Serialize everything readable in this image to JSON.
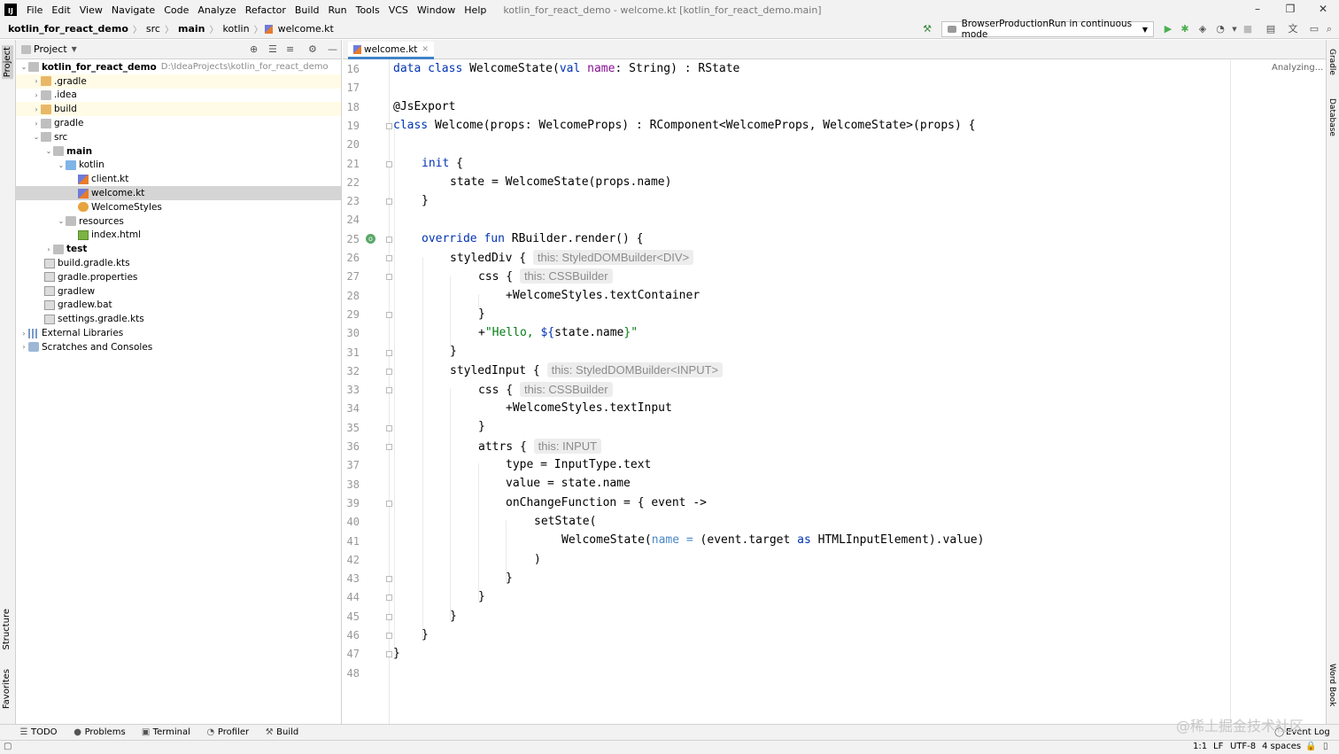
{
  "title_bar": {
    "app_icon": "intellij-icon",
    "menu": [
      "File",
      "Edit",
      "View",
      "Navigate",
      "Code",
      "Analyze",
      "Refactor",
      "Build",
      "Run",
      "Tools",
      "VCS",
      "Window",
      "Help"
    ],
    "window_title": "kotlin_for_react_demo - welcome.kt [kotlin_for_react_demo.main]"
  },
  "breadcrumbs": [
    "kotlin_for_react_demo",
    "src",
    "main",
    "kotlin",
    "welcome.kt"
  ],
  "run_config": "BrowserProductionRun in continuous mode",
  "left_strip": {
    "project": "Project",
    "structure": "Structure",
    "favorites": "Favorites"
  },
  "right_strip": {
    "gradle": "Gradle",
    "database": "Database",
    "word_book": "Word Book"
  },
  "project_panel": {
    "header": "Project",
    "tree": [
      {
        "label": "kotlin_for_react_demo",
        "hint": "D:\\IdeaProjects\\kotlin_for_react_demo",
        "bold": true
      },
      {
        "label": ".gradle"
      },
      {
        "label": ".idea"
      },
      {
        "label": "build"
      },
      {
        "label": "gradle"
      },
      {
        "label": "src"
      },
      {
        "label": "main",
        "bold": true
      },
      {
        "label": "kotlin"
      },
      {
        "label": "client.kt"
      },
      {
        "label": "welcome.kt"
      },
      {
        "label": "WelcomeStyles"
      },
      {
        "label": "resources"
      },
      {
        "label": "index.html"
      },
      {
        "label": "test",
        "bold": true
      },
      {
        "label": "build.gradle.kts"
      },
      {
        "label": "gradle.properties"
      },
      {
        "label": "gradlew"
      },
      {
        "label": "gradlew.bat"
      },
      {
        "label": "settings.gradle.kts"
      },
      {
        "label": "External Libraries"
      },
      {
        "label": "Scratches and Consoles"
      }
    ]
  },
  "editor": {
    "tab": "welcome.kt",
    "status": "Analyzing...",
    "line_numbers": [
      "16",
      "17",
      "18",
      "19",
      "20",
      "21",
      "22",
      "23",
      "24",
      "25",
      "26",
      "27",
      "28",
      "29",
      "30",
      "31",
      "32",
      "33",
      "34",
      "35",
      "36",
      "37",
      "38",
      "39",
      "40",
      "41",
      "42",
      "43",
      "44",
      "45",
      "46",
      "47",
      "48"
    ],
    "lines": {
      "l16": {
        "a": "data class ",
        "b": "WelcomeState(",
        "c": "val ",
        "d": "name",
        "e": ": String) : RState"
      },
      "l18": "@JsExport",
      "l19": {
        "a": "class ",
        "b": "Welcome(props: WelcomeProps) : RComponent<WelcomeProps, WelcomeState>(props) {"
      },
      "l21": {
        "a": "init ",
        "b": "{"
      },
      "l22": "state = WelcomeState(props.name)",
      "l23": "}",
      "l25": {
        "a": "override fun ",
        "b": "RBuilder.render() {"
      },
      "l26": {
        "a": "styledDiv {",
        "hint": "this: StyledDOMBuilder<DIV>"
      },
      "l27": {
        "a": "css {",
        "hint": "this: CSSBuilder"
      },
      "l28": "+WelcomeStyles.textContainer",
      "l29": "}",
      "l30": {
        "a": "+",
        "b": "\"Hello, ",
        "c": "${",
        "d": "state.name",
        "e": "}\""
      },
      "l31": "}",
      "l32": {
        "a": "styledInput {",
        "hint": "this: StyledDOMBuilder<INPUT>"
      },
      "l33": {
        "a": "css {",
        "hint": "this: CSSBuilder"
      },
      "l34": "+WelcomeStyles.textInput",
      "l35": "}",
      "l36": {
        "a": "attrs {",
        "hint": "this: INPUT"
      },
      "l37": "type = InputType.text",
      "l38": "value = state.name",
      "l39": "onChangeFunction = { event ->",
      "l40": "setState(",
      "l41": {
        "a": "WelcomeState(",
        "b": "name = ",
        "c": "(event.target ",
        "d": "as ",
        "e": "HTMLInputElement).value)"
      },
      "l42": ")",
      "l43": "}",
      "l44": "}",
      "l45": "}",
      "l46": "}",
      "l47": "}"
    }
  },
  "bottom_tabs": [
    "TODO",
    "Problems",
    "Terminal",
    "Profiler",
    "Build"
  ],
  "event_log": "Event Log",
  "status_bar": {
    "position": "1:1",
    "line_sep": "LF",
    "encoding": "UTF-8",
    "indent": "4 spaces"
  },
  "watermark": "@稀土掘金技术社区",
  "colors": {
    "keyword": "#0033b3",
    "string": "#067d17",
    "param": "#871094",
    "hint_bg": "#ededed",
    "selection": "#d5d5d5"
  }
}
